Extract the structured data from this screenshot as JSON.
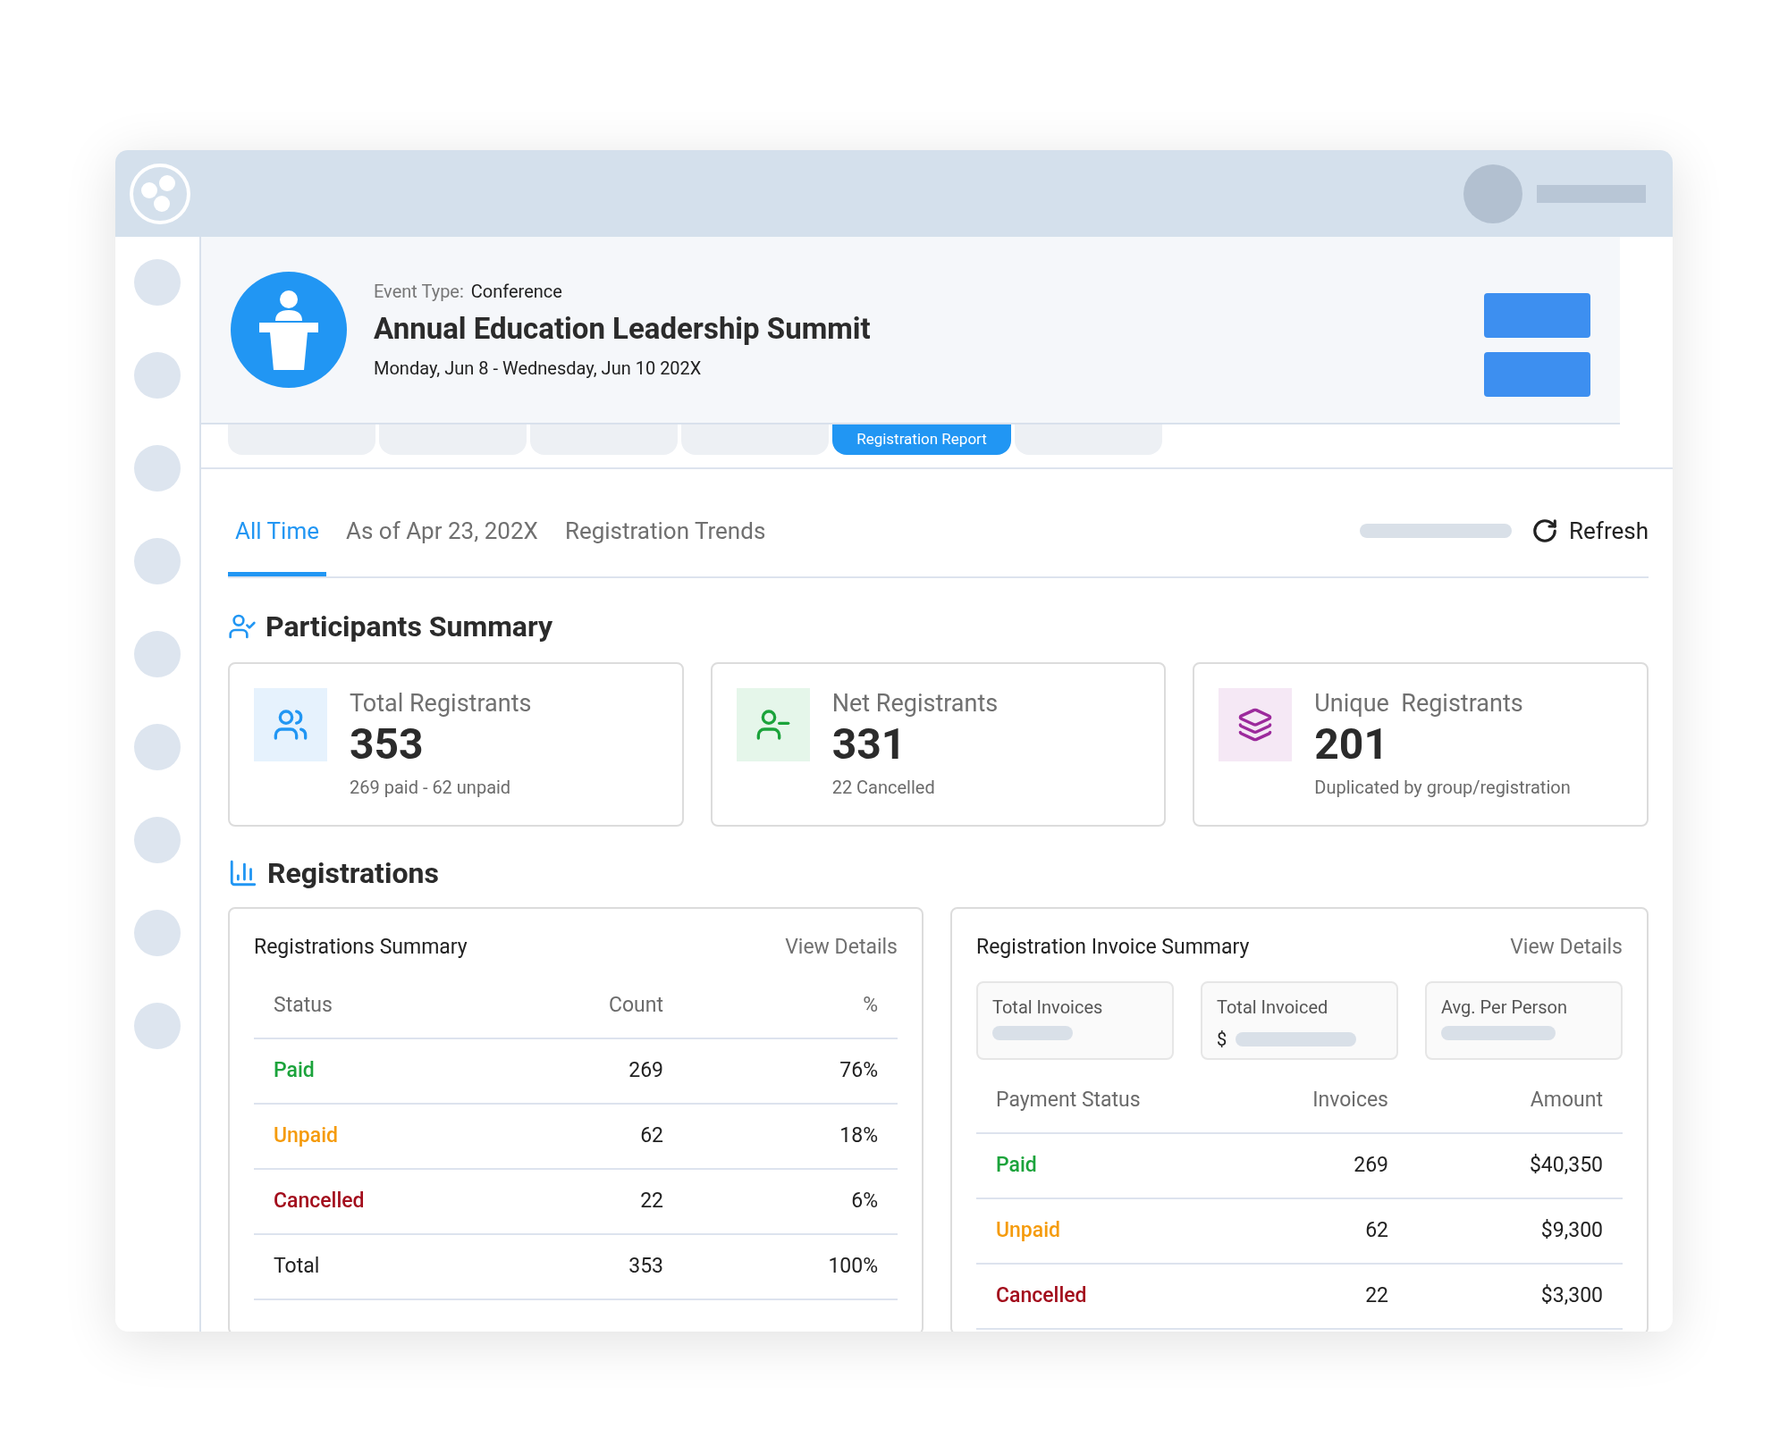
{
  "event": {
    "type_label": "Event Type:",
    "type_value": "Conference",
    "title": "Annual Education Leadership Summit",
    "dates": "Monday, Jun 8 - Wednesday, Jun 10 202X"
  },
  "nav_tabs": [
    {
      "selected": false
    },
    {
      "selected": false
    },
    {
      "selected": false
    },
    {
      "selected": false
    },
    {
      "label": "Registration Report",
      "selected": true
    },
    {
      "selected": false
    }
  ],
  "view_tabs": [
    {
      "label": "All Time",
      "selected": true
    },
    {
      "label": "As of Apr 23, 202X",
      "selected": false
    },
    {
      "label": "Registration Trends",
      "selected": false
    }
  ],
  "refresh": "Refresh",
  "participants": {
    "title": "Participants Summary",
    "cards": [
      {
        "kind": "users",
        "title": "Total Registrants",
        "value": "353",
        "note": "269 paid - 62 unpaid"
      },
      {
        "kind": "user-minus",
        "title": "Net Registrants",
        "value": "331",
        "note": "22 Cancelled"
      },
      {
        "kind": "layers",
        "title": "Unique  Registrants",
        "value": "201",
        "note": "Duplicated by group/registration"
      }
    ]
  },
  "registrations": {
    "title": "Registrations",
    "summary": {
      "title": "Registrations Summary",
      "link": "View Details",
      "columns": [
        "Status",
        "Count",
        "%"
      ],
      "rows": [
        {
          "cells": [
            "Paid",
            "269",
            "76%"
          ],
          "color": "#1ba33b"
        },
        {
          "cells": [
            "Unpaid",
            "62",
            "18%"
          ],
          "color": "#f59b0c"
        },
        {
          "cells": [
            "Cancelled",
            "22",
            "6%"
          ],
          "color": "#a30d1c"
        },
        {
          "cells": [
            "Total",
            "353",
            "100%"
          ],
          "color": "#222222"
        }
      ]
    },
    "invoice": {
      "title": "Registration Invoice Summary",
      "link": "View Details",
      "stats": [
        {
          "label": "Total Invoices"
        },
        {
          "label": "Total Invoiced",
          "prefix": "$"
        },
        {
          "label": "Avg. Per Person"
        }
      ],
      "columns": [
        "Payment Status",
        "Invoices",
        "Amount"
      ],
      "rows": [
        {
          "cells": [
            "Paid",
            "269",
            "$40,350"
          ],
          "color": "#1ba33b"
        },
        {
          "cells": [
            "Unpaid",
            "62",
            "$9,300"
          ],
          "color": "#f59b0c"
        },
        {
          "cells": [
            "Cancelled",
            "22",
            "$3,300"
          ],
          "color": "#a30d1c"
        }
      ]
    }
  }
}
